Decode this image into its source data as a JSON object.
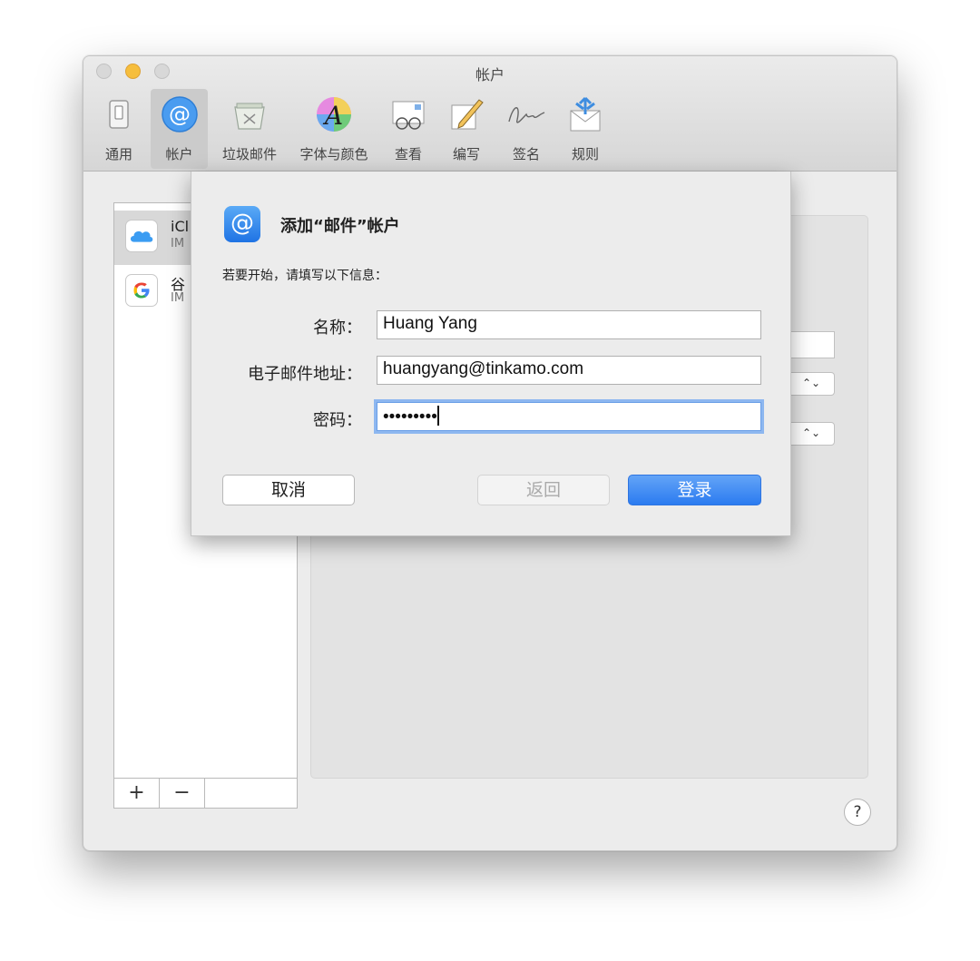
{
  "window": {
    "title": "帐户"
  },
  "toolbar": {
    "items": [
      {
        "label": "通用",
        "icon": "general-switch-icon"
      },
      {
        "label": "帐户",
        "icon": "at-sign-icon",
        "active": true
      },
      {
        "label": "垃圾邮件",
        "icon": "junk-mail-bin-icon"
      },
      {
        "label": "字体与颜色",
        "icon": "fonts-colors-icon"
      },
      {
        "label": "查看",
        "icon": "viewing-glasses-icon"
      },
      {
        "label": "编写",
        "icon": "composing-pencil-icon"
      },
      {
        "label": "签名",
        "icon": "signature-icon"
      },
      {
        "label": "规则",
        "icon": "rules-envelope-icon"
      }
    ]
  },
  "accounts": [
    {
      "name": "iCl",
      "type": "IM",
      "icon": "icloud-icon"
    },
    {
      "name": "谷",
      "type": "IM",
      "icon": "google-icon"
    }
  ],
  "list_controls": {
    "add": "+",
    "remove": "−"
  },
  "help": {
    "label": "?"
  },
  "sheet": {
    "title": "添加“邮件”帐户",
    "description": "若要开始，请填写以下信息：",
    "fields": {
      "name_label": "名称：",
      "name_value": "Huang Yang",
      "email_label": "电子邮件地址：",
      "email_value": "huangyang@tinkamo.com",
      "password_label": "密码：",
      "password_value": "•••••••••"
    },
    "buttons": {
      "cancel": "取消",
      "back": "返回",
      "login": "登录"
    }
  },
  "colors": {
    "accent": "#2b7bf0",
    "minimize": "#f6be3d"
  }
}
